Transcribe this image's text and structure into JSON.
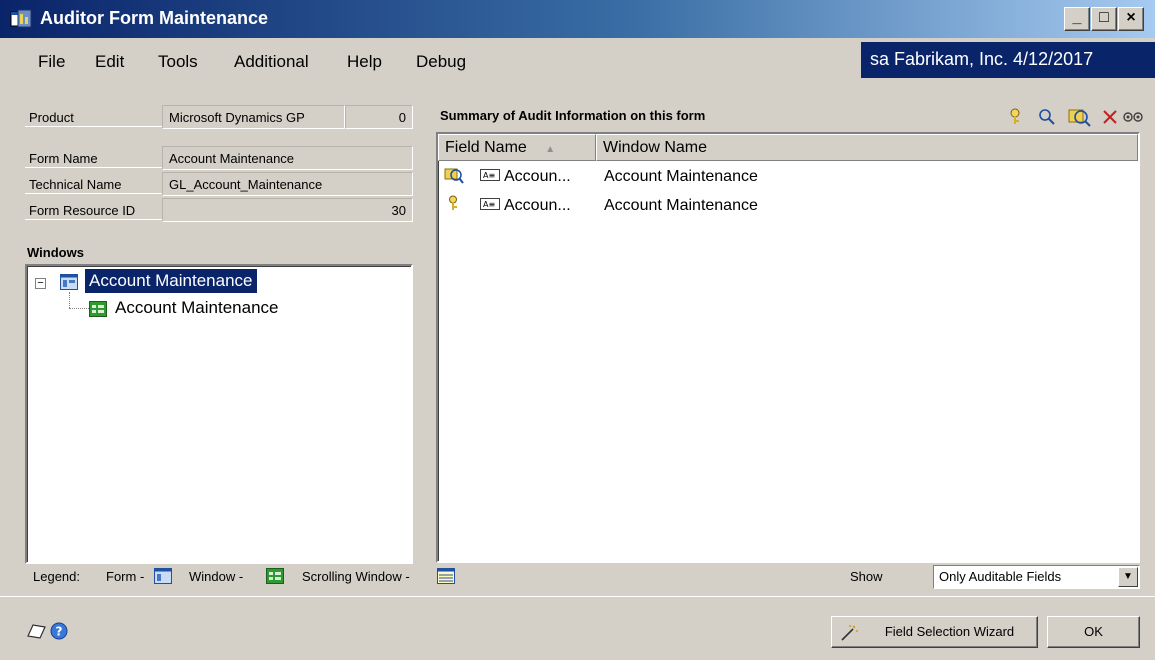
{
  "window": {
    "title": "Auditor Form Maintenance"
  },
  "menu": {
    "items": [
      "File",
      "Edit",
      "Tools",
      "Additional",
      "Help",
      "Debug"
    ]
  },
  "user_info": "sa  Fabrikam, Inc.  4/12/2017",
  "form_info": {
    "product_label": "Product",
    "product_value": "Microsoft Dynamics GP",
    "product_id": "0",
    "form_name_label": "Form Name",
    "form_name_value": "Account Maintenance",
    "technical_name_label": "Technical Name",
    "technical_name_value": "GL_Account_Maintenance",
    "resource_id_label": "Form Resource ID",
    "resource_id_value": "30"
  },
  "windows_section": {
    "title": "Windows",
    "tree": {
      "root_label": "Account Maintenance",
      "child_label": "Account Maintenance"
    }
  },
  "summary": {
    "title": "Summary of Audit Information on this form",
    "columns": [
      "Field Name",
      "Window Name"
    ],
    "rows": [
      {
        "icon": "audit-icon",
        "field": "Accoun...",
        "window": "Account Maintenance"
      },
      {
        "icon": "key-icon",
        "field": "Accoun...",
        "window": "Account Maintenance"
      }
    ]
  },
  "legend": {
    "label": "Legend:",
    "form": "Form -",
    "window": "Window -",
    "scrolling_window": "Scrolling Window -"
  },
  "show": {
    "label": "Show",
    "selected": "Only Auditable Fields"
  },
  "buttons": {
    "wizard": "Field Selection Wizard",
    "ok": "OK"
  }
}
